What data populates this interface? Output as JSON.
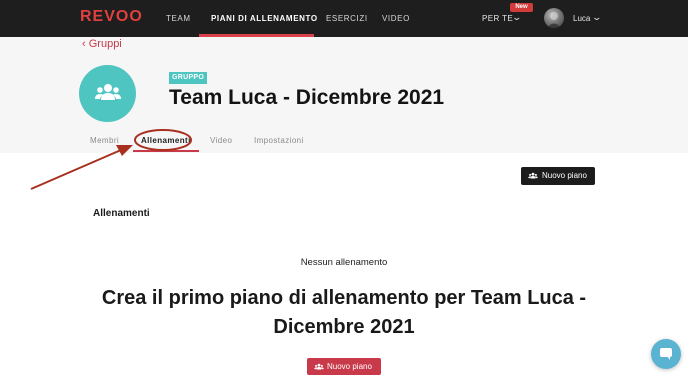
{
  "app": {
    "logo": "REVOO"
  },
  "nav": {
    "items": [
      {
        "label": "TEAM"
      },
      {
        "label": "PIANI DI ALLENAMENTO"
      },
      {
        "label": "ESERCIZI"
      },
      {
        "label": "VIDEO"
      }
    ],
    "for_you": "PER TE",
    "new_badge": "New",
    "user_name": "Luca"
  },
  "breadcrumb": {
    "label": "Gruppi"
  },
  "group": {
    "tag": "GRUPPO",
    "title": "Team Luca - Dicembre 2021"
  },
  "tabs": [
    {
      "label": "Membri"
    },
    {
      "label": "Allenamenti"
    },
    {
      "label": "Video"
    },
    {
      "label": "Impostazioni"
    }
  ],
  "main": {
    "new_plan_button": "Nuovo piano",
    "section_title": "Allenamenti",
    "empty_message": "Nessun allenamento",
    "cta_title": "Crea il primo piano di allenamento per Team Luca - Dicembre 2021",
    "cta_button": "Nuovo piano"
  },
  "colors": {
    "brand_red": "#c8394a",
    "teal": "#4ec5c1",
    "nav_bg": "#1e1e1e",
    "annotation": "#a8301f"
  },
  "icons": {
    "group": "group-icon",
    "chevron_left": "chevron-left-icon",
    "chevron_down": "chevron-down-icon",
    "chat": "chat-icon"
  }
}
